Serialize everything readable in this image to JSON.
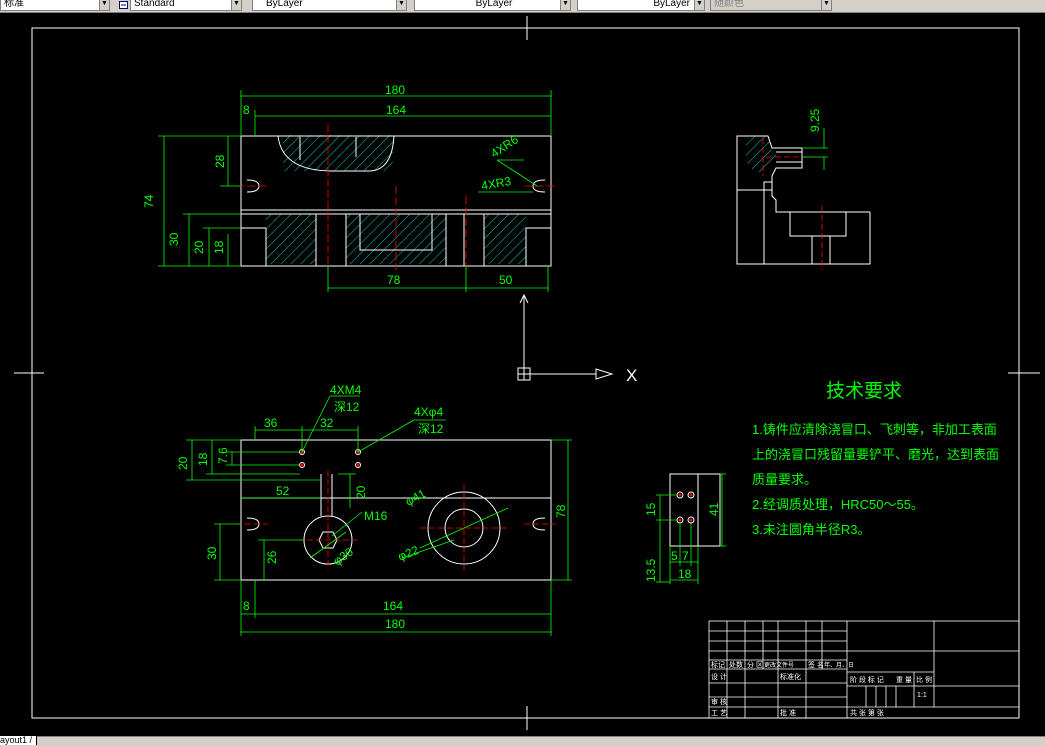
{
  "toolbar": {
    "text_style": "标准",
    "dim_style": "Standard",
    "layer": "ByLayer",
    "linetype": "ByLayer",
    "lineweight": "ByLayer",
    "plot_style": "随颜色"
  },
  "status": {
    "layout_tab": "ayout1 /"
  },
  "ucs": {
    "x_label": "X"
  },
  "dims": {
    "top": {
      "w180": "180",
      "w164": "164",
      "w8": "8",
      "h28": "28",
      "h74": "74",
      "h30": "30",
      "h20": "20",
      "h18": "18",
      "w78": "78",
      "w50": "50",
      "r6": "4XR6",
      "r3": "4XR3"
    },
    "side": {
      "d925": "9.25"
    },
    "plan": {
      "m4": "4XM4",
      "m4_depth": "深12",
      "d4": "4Xφ4",
      "d4_depth": "深12",
      "w36": "36",
      "w32": "32",
      "h20": "20",
      "h18": "18",
      "h76": "7.6",
      "w52": "52",
      "h20b": "20",
      "m16": "M16",
      "d41": "φ41",
      "d22": "φ22",
      "d30": "φ30",
      "h78": "78",
      "h30": "30",
      "h26": "26",
      "w8": "8",
      "w164": "164",
      "w180": "180"
    },
    "detail": {
      "h15": "15",
      "h41": "41",
      "w5": "5",
      "w7": "7",
      "h135": "13.5",
      "w18": "18"
    }
  },
  "notes": {
    "title": "技术要求",
    "line1": "1.铸件应清除浇冒口、飞刺等，非加工表面",
    "line2": "上的浇冒口残留量要铲平、磨光，达到表面",
    "line3": "质量要求。",
    "line4": "2.经调质处理，HRC50～55。",
    "line5": "3.未注圆角半径R3。"
  },
  "title_block": {
    "c1": "标记",
    "c2": "处数",
    "c3": "分 区",
    "c4": "更改文件号",
    "c5": "签 名",
    "c6": "年、月、日",
    "design": "设 计",
    "standard": "标准化",
    "check": "审 核",
    "process": "工 艺",
    "approve": "批 准",
    "stage": "阶 段 标 记",
    "weight": "重 量",
    "scale": "比 例",
    "scale_val": "1:1",
    "sheets": "共   张   第   张"
  }
}
